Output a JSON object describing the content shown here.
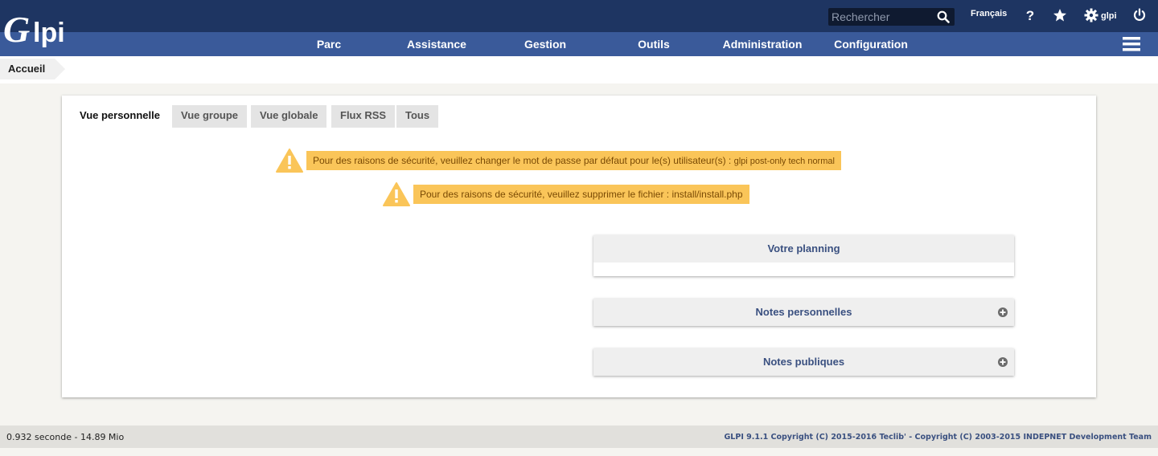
{
  "header": {
    "logo_text": "Glpi",
    "search_placeholder": "Rechercher",
    "language": "Français",
    "user": "glpi",
    "icons": [
      "search-icon",
      "help-icon",
      "star-icon",
      "gear-icon",
      "power-icon"
    ],
    "colors": {
      "topbar": "#1e3562",
      "menubar": "#3a5a9a"
    }
  },
  "menu": {
    "items": [
      {
        "label": "Parc"
      },
      {
        "label": "Assistance"
      },
      {
        "label": "Gestion"
      },
      {
        "label": "Outils"
      },
      {
        "label": "Administration"
      },
      {
        "label": "Configuration"
      }
    ]
  },
  "breadcrumb": {
    "home": "Accueil"
  },
  "tabs": [
    {
      "label": "Vue personnelle",
      "active": true
    },
    {
      "label": "Vue groupe",
      "active": false
    },
    {
      "label": "Vue globale",
      "active": false
    },
    {
      "label": "Flux RSS",
      "active": false
    },
    {
      "label": "Tous",
      "active": false
    }
  ],
  "warnings": [
    {
      "text": "Pour des raisons de sécurité, veuillez changer le mot de passe par défaut pour le(s) utilisateur(s) :",
      "users": "glpi post-only tech normal"
    },
    {
      "text": "Pour des raisons de sécurité, veuillez supprimer le fichier : install/install.php"
    }
  ],
  "panels": {
    "planning": "Votre planning",
    "personal_notes": "Notes personnelles",
    "public_notes": "Notes publiques"
  },
  "footer": {
    "timing": "0.932 seconde - 14.89 Mio",
    "copyright": "GLPI 9.1.1 Copyright (C) 2015-2016 Teclib' - Copyright (C) 2003-2015 INDEPNET Development Team"
  },
  "warning_color": "#fac559"
}
